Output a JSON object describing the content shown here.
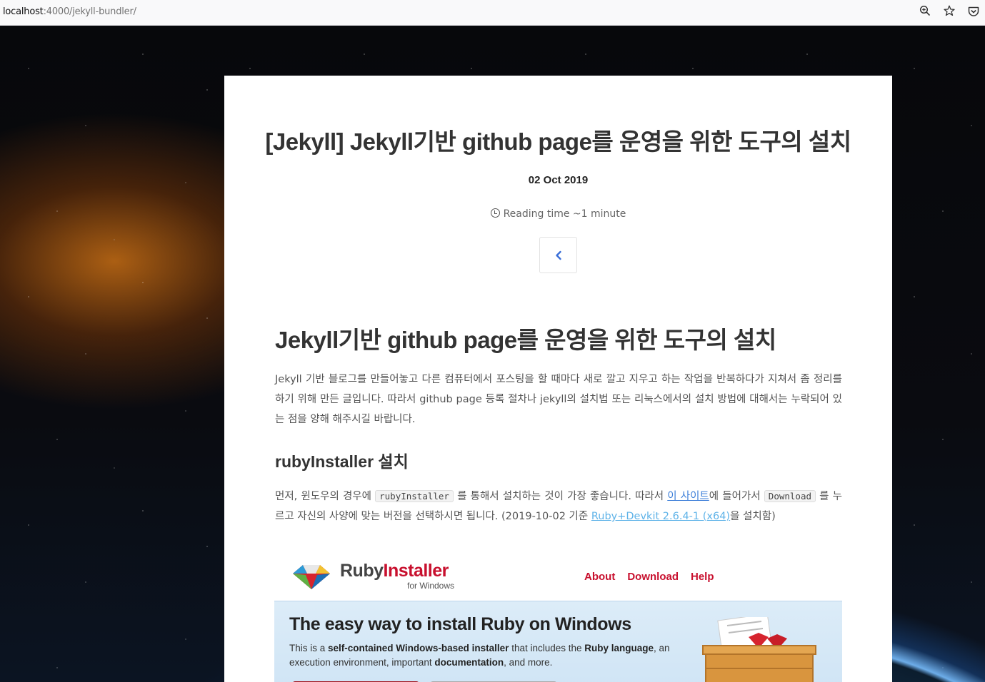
{
  "browser": {
    "url_host": "localhost",
    "url_rest": ":4000/jekyll-bundler/",
    "icons": [
      "zoom-icon",
      "bookmark-star-icon",
      "pocket-icon"
    ]
  },
  "post": {
    "title": "[Jekyll] Jekyll기반 github page를 운영을 위한 도구의 설치",
    "date": "02 Oct 2019",
    "reading_time": "Reading time ~1 minute",
    "back_icon": "‹"
  },
  "content": {
    "h1": "Jekyll기반 github page를 운영을 위한 도구의 설치",
    "p1": "Jekyll 기반 블로그를 만들어놓고 다른 컴퓨터에서 포스팅을 할 때마다 새로 깔고 지우고 하는 작업을 반복하다가 지쳐서 좀 정리를 하기 위해 만든 글입니다. 따라서 github page 등록 절차나 jekyll의 설치법 또는 리눅스에서의 설치 방법에 대해서는 누락되어 있는 점을 양해 해주시길 바랍니다.",
    "h2": "rubyInstaller 설치",
    "p2_a": "먼저, 윈도우의 경우에 ",
    "p2_code1": "rubyInstaller",
    "p2_b": " 를 통해서 설치하는 것이 가장 좋습니다. 따라서 ",
    "p2_link1": "이 사이트",
    "p2_c": "에 들어가서 ",
    "p2_code2": "Download",
    "p2_d": " 를 누르고 자신의 사양에 맞는 버전을 선택하시면 됩니다. (2019-10-02 기준 ",
    "p2_link2": "Ruby+Devkit 2.6.4-1 (x64)",
    "p2_e": "을 설치함)"
  },
  "rubyinstaller_image": {
    "logo_ruby": "Ruby",
    "logo_installer": "Installer",
    "logo_sub": "for Windows",
    "nav": [
      "About",
      "Download",
      "Help"
    ],
    "headline": "The easy way to install Ruby on Windows",
    "desc_1": "This is a ",
    "desc_b1": "self-contained Windows-based installer",
    "desc_2": " that includes the ",
    "desc_b2": "Ruby language",
    "desc_3": ", an execution environment, important ",
    "desc_b3": "documentation",
    "desc_4": ", and more."
  }
}
